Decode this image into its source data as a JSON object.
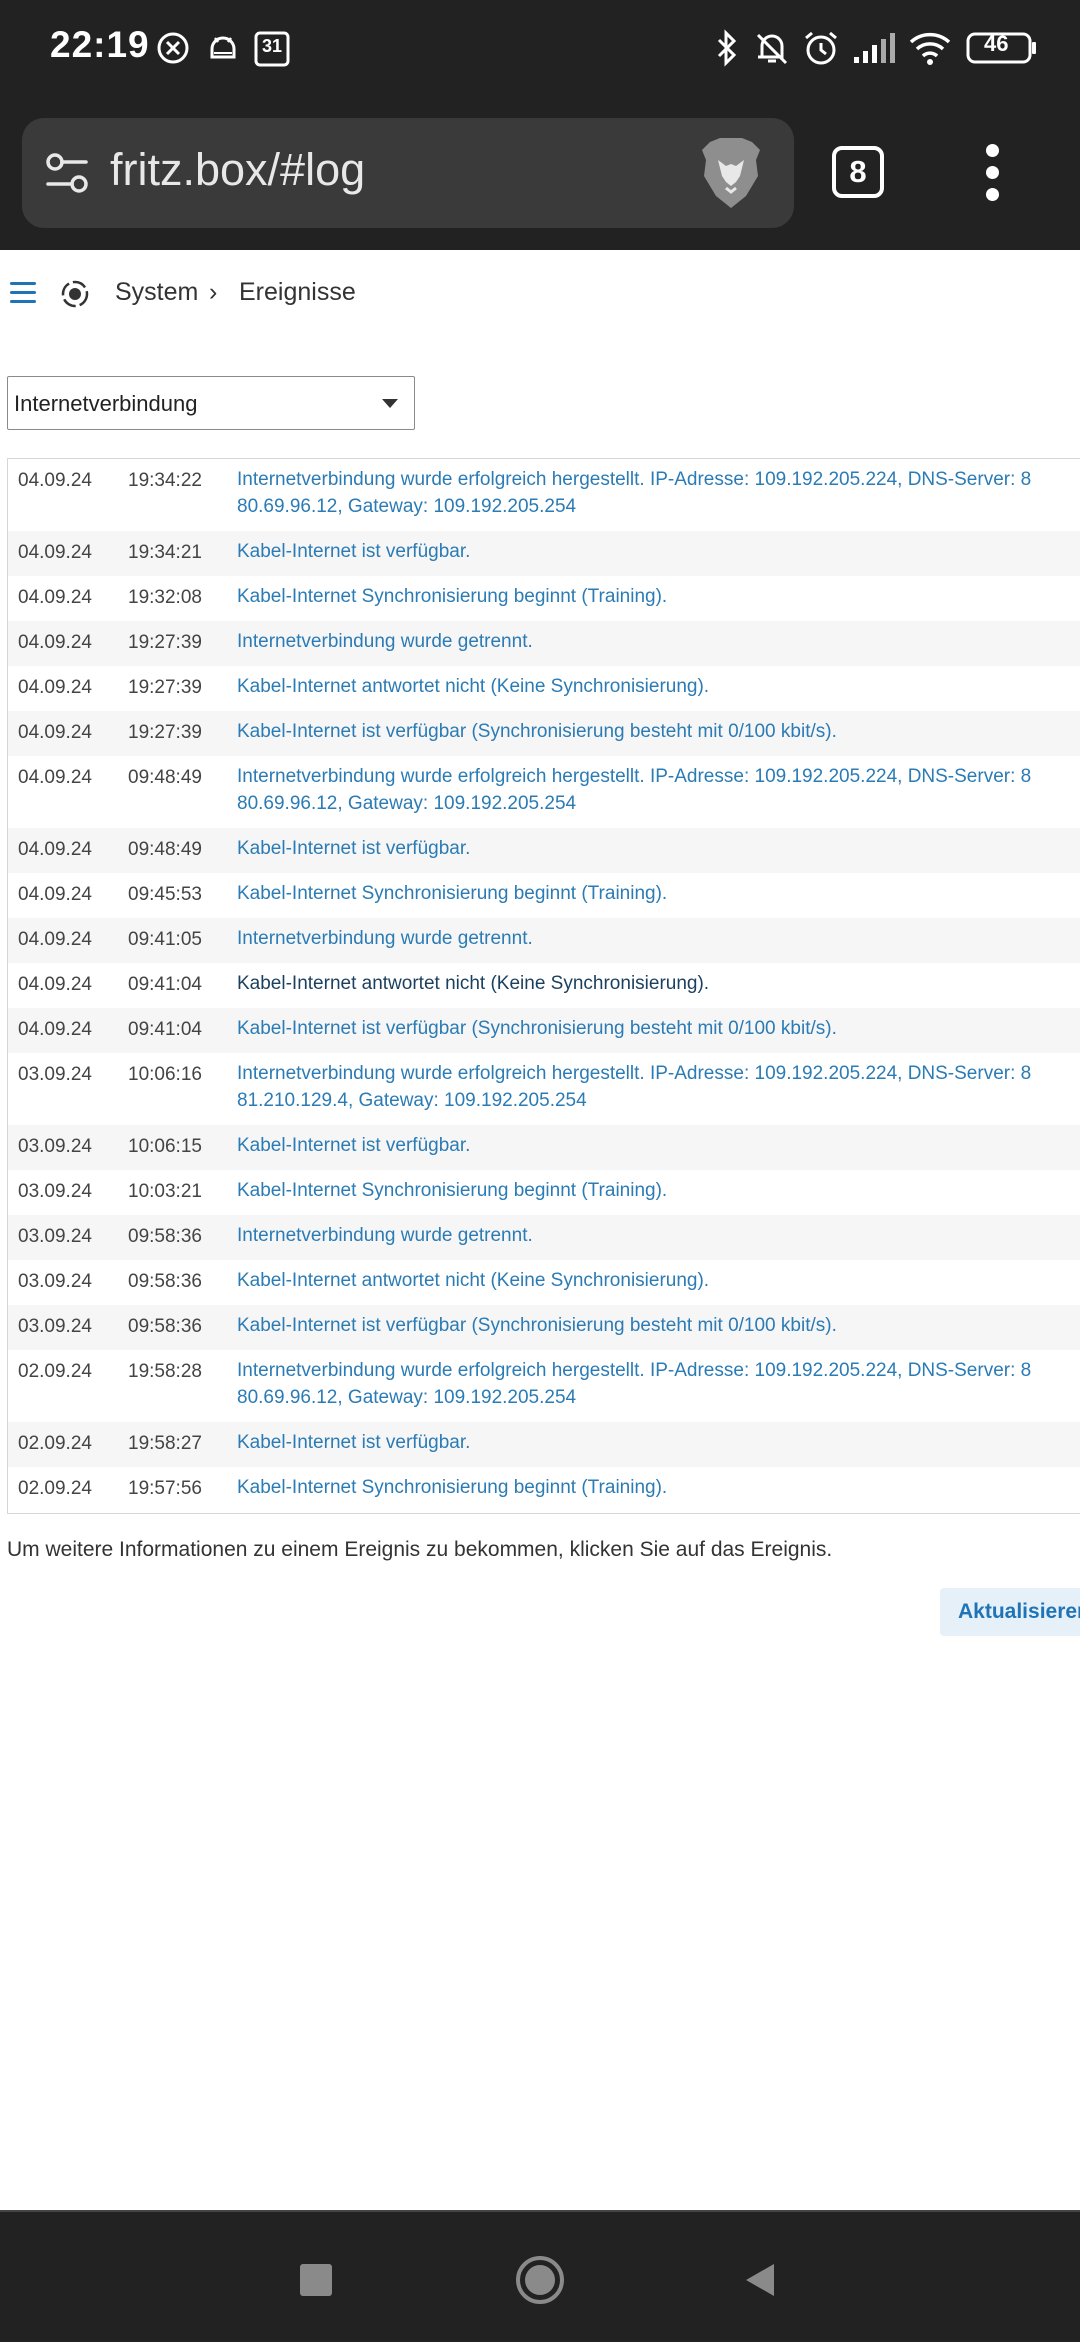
{
  "status_bar": {
    "time": "22:19",
    "calendar_day": "31",
    "battery": "46",
    "icons": [
      "x-notification-icon",
      "android-icon",
      "calendar-icon",
      "bluetooth-icon",
      "mute-icon",
      "alarm-icon",
      "signal-icon",
      "wifi-icon",
      "battery-icon"
    ]
  },
  "browser": {
    "url": "fritz.box/#log",
    "tab_count": "8"
  },
  "breadcrumb": {
    "system": "System",
    "events": "Ereignisse"
  },
  "filter": {
    "selected": "Internetverbindung"
  },
  "log": [
    {
      "date": "04.09.24",
      "time": "19:34:22",
      "msg": "Internetverbindung wurde erfolgreich hergestellt. IP-Adresse: 109.192.205.224, DNS-Server: 8",
      "msg2": "80.69.96.12, Gateway: 109.192.205.254"
    },
    {
      "date": "04.09.24",
      "time": "19:34:21",
      "msg": "Kabel-Internet ist verfügbar."
    },
    {
      "date": "04.09.24",
      "time": "19:32:08",
      "msg": "Kabel-Internet Synchronisierung beginnt (Training)."
    },
    {
      "date": "04.09.24",
      "time": "19:27:39",
      "msg": "Internetverbindung wurde getrennt."
    },
    {
      "date": "04.09.24",
      "time": "19:27:39",
      "msg": "Kabel-Internet antwortet nicht (Keine Synchronisierung)."
    },
    {
      "date": "04.09.24",
      "time": "19:27:39",
      "msg": "Kabel-Internet ist verfügbar (Synchronisierung besteht mit 0/100 kbit/s)."
    },
    {
      "date": "04.09.24",
      "time": "09:48:49",
      "msg": "Internetverbindung wurde erfolgreich hergestellt. IP-Adresse: 109.192.205.224, DNS-Server: 8",
      "msg2": "80.69.96.12, Gateway: 109.192.205.254"
    },
    {
      "date": "04.09.24",
      "time": "09:48:49",
      "msg": "Kabel-Internet ist verfügbar."
    },
    {
      "date": "04.09.24",
      "time": "09:45:53",
      "msg": "Kabel-Internet Synchronisierung beginnt (Training)."
    },
    {
      "date": "04.09.24",
      "time": "09:41:05",
      "msg": "Internetverbindung wurde getrennt."
    },
    {
      "date": "04.09.24",
      "time": "09:41:04",
      "msg": "Kabel-Internet antwortet nicht (Keine Synchronisierung).",
      "dark": true
    },
    {
      "date": "04.09.24",
      "time": "09:41:04",
      "msg": "Kabel-Internet ist verfügbar (Synchronisierung besteht mit 0/100 kbit/s)."
    },
    {
      "date": "03.09.24",
      "time": "10:06:16",
      "msg": "Internetverbindung wurde erfolgreich hergestellt. IP-Adresse: 109.192.205.224, DNS-Server: 8",
      "msg2": "81.210.129.4, Gateway: 109.192.205.254"
    },
    {
      "date": "03.09.24",
      "time": "10:06:15",
      "msg": "Kabel-Internet ist verfügbar."
    },
    {
      "date": "03.09.24",
      "time": "10:03:21",
      "msg": "Kabel-Internet Synchronisierung beginnt (Training)."
    },
    {
      "date": "03.09.24",
      "time": "09:58:36",
      "msg": "Internetverbindung wurde getrennt."
    },
    {
      "date": "03.09.24",
      "time": "09:58:36",
      "msg": "Kabel-Internet antwortet nicht (Keine Synchronisierung)."
    },
    {
      "date": "03.09.24",
      "time": "09:58:36",
      "msg": "Kabel-Internet ist verfügbar (Synchronisierung besteht mit 0/100 kbit/s)."
    },
    {
      "date": "02.09.24",
      "time": "19:58:28",
      "msg": "Internetverbindung wurde erfolgreich hergestellt. IP-Adresse: 109.192.205.224, DNS-Server: 8",
      "msg2": "80.69.96.12, Gateway: 109.192.205.254"
    },
    {
      "date": "02.09.24",
      "time": "19:58:27",
      "msg": "Kabel-Internet ist verfügbar."
    },
    {
      "date": "02.09.24",
      "time": "19:57:56",
      "msg": "Kabel-Internet Synchronisierung beginnt (Training)."
    }
  ],
  "footer": {
    "hint": "Um weitere Informationen zu einem Ereignis zu bekommen, klicken Sie auf das Ereignis.",
    "refresh_label": "Aktualisieren"
  },
  "colors": {
    "link": "#2b7bb5",
    "accent": "#1f74b8",
    "bar_bg": "#222222"
  }
}
